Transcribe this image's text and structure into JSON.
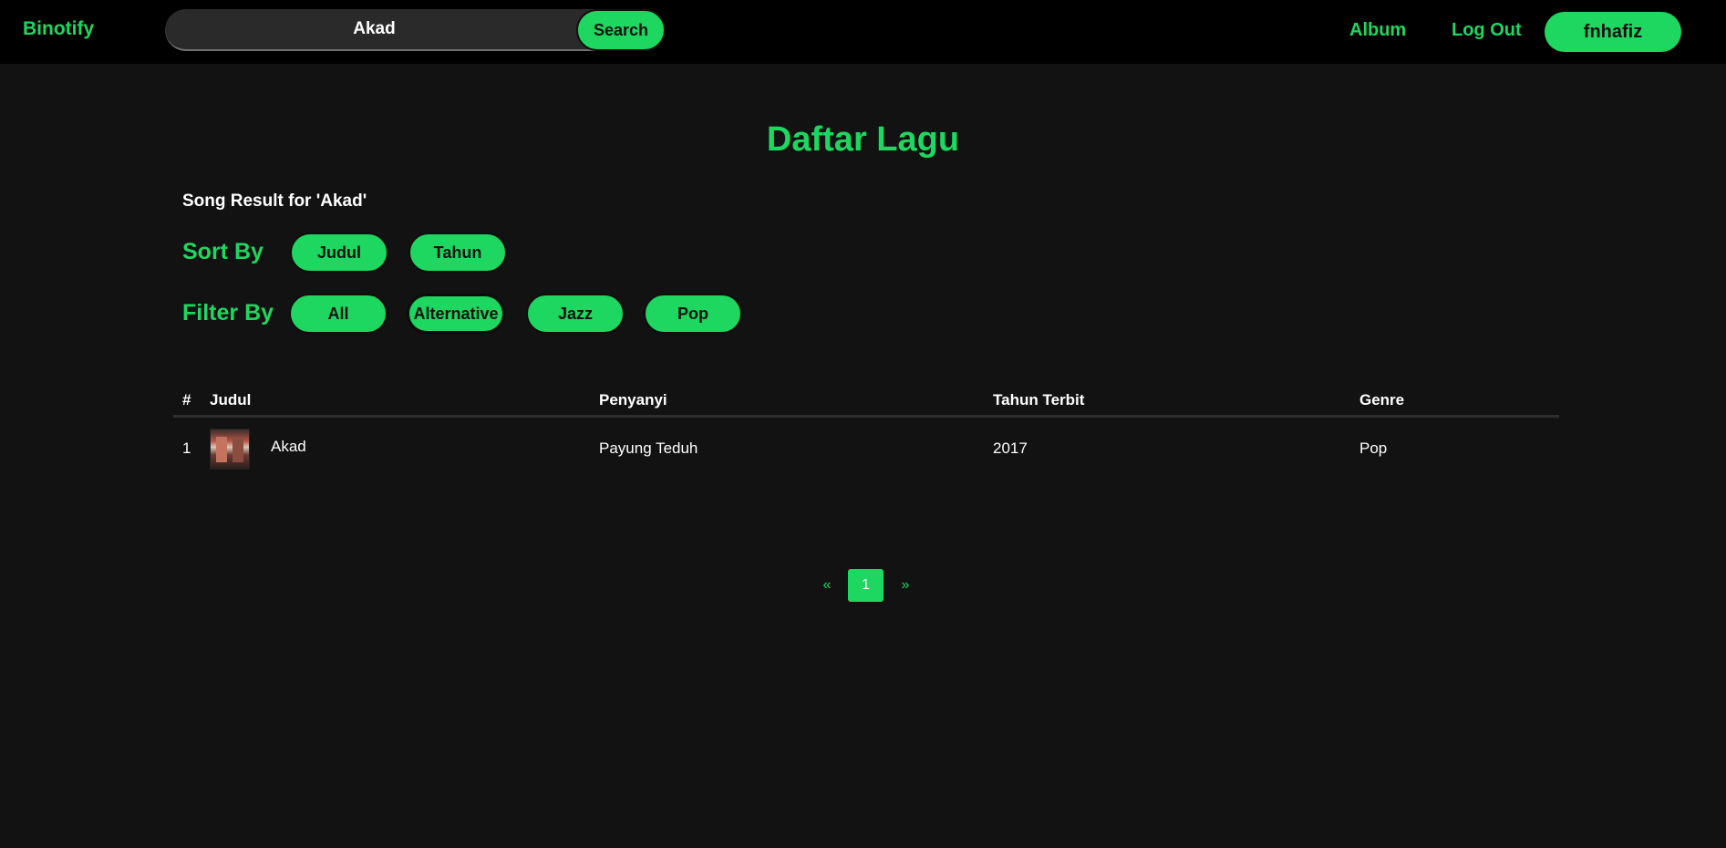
{
  "header": {
    "brand": "Binotify",
    "search_value": "Akad",
    "search_button": "Search",
    "album_link": "Album",
    "logout_link": "Log Out",
    "username": "fnhafiz"
  },
  "main": {
    "title": "Daftar Lagu",
    "result_text": "Song Result for 'Akad'",
    "sort_label": "Sort By",
    "sort_options": [
      "Judul",
      "Tahun"
    ],
    "filter_label": "Filter By",
    "filter_options": [
      "All",
      "Alternative",
      "Jazz",
      "Pop"
    ]
  },
  "table": {
    "headers": {
      "num": "#",
      "title": "Judul",
      "singer": "Penyanyi",
      "year": "Tahun Terbit",
      "genre": "Genre"
    },
    "rows": [
      {
        "num": "1",
        "title": "Akad",
        "singer": "Payung Teduh",
        "year": "2017",
        "genre": "Pop",
        "cover_icon": "album-cover-image"
      }
    ]
  },
  "pagination": {
    "prev": "«",
    "current": "1",
    "next": "»"
  },
  "colors": {
    "accent": "#1ed760",
    "background": "#121212",
    "navbar": "#000000"
  }
}
